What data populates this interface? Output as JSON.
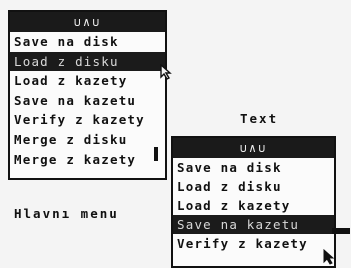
{
  "menu_a": {
    "title": "∪∧∪",
    "items": [
      {
        "label": "Save na disk"
      },
      {
        "label": "Load z disku"
      },
      {
        "label": "Load z kazety"
      },
      {
        "label": "Save na kazetu"
      },
      {
        "label": "Verify z kazety"
      },
      {
        "label": "Merge z disku"
      },
      {
        "label": "Merge z kazety"
      }
    ],
    "highlighted_index": 1
  },
  "menu_b": {
    "title": "∪∧∪",
    "items": [
      {
        "label": "Save na disk"
      },
      {
        "label": "Load z disku"
      },
      {
        "label": "Load z kazety"
      },
      {
        "label": "Save na kazetu"
      },
      {
        "label": "Verify z kazety"
      }
    ],
    "highlighted_index": 3
  },
  "captions": {
    "text": "Text",
    "main": "Hlavnı menu"
  },
  "colors": {
    "background": "#f4f4f4",
    "menu_bg": "#fbfbfb",
    "highlight_bg": "#1b1b1b",
    "ink": "#111111"
  },
  "icons": [
    "arrow-cursor-icon",
    "arrow-cursor-icon"
  ]
}
